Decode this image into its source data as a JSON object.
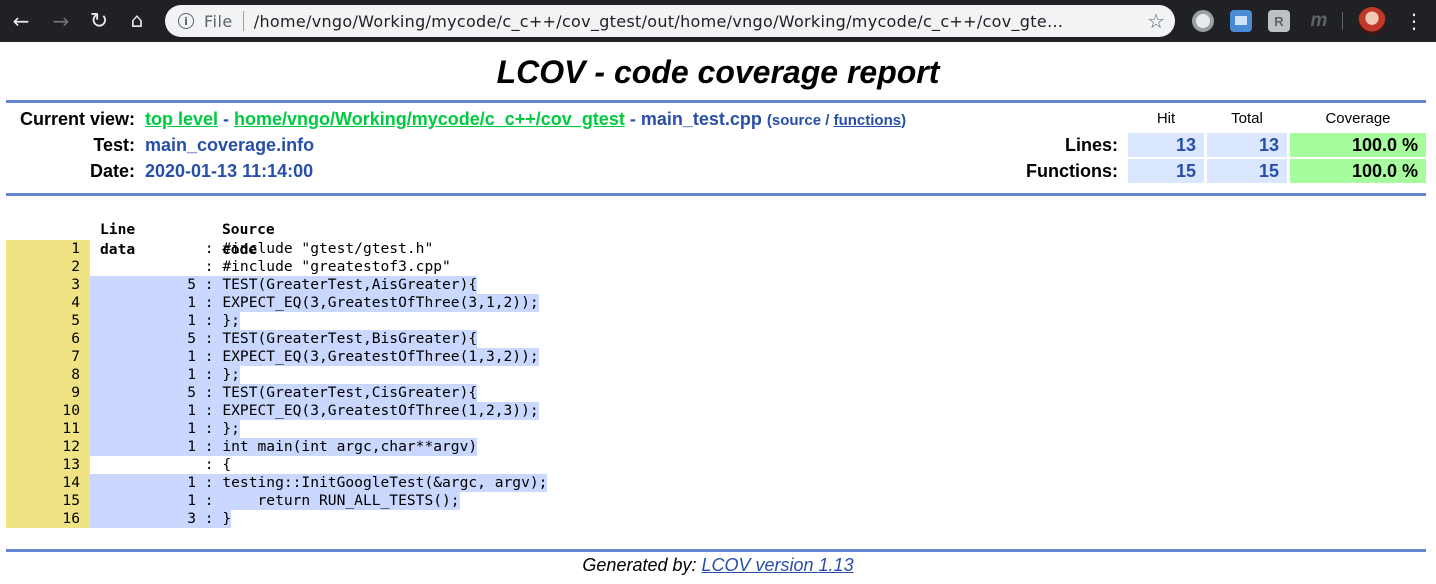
{
  "browser": {
    "back_icon": "arrow-left-icon",
    "forward_icon": "arrow-right-icon",
    "reload_icon": "reload-icon",
    "home_icon": "home-icon",
    "scheme_label": "File",
    "url": "/home/vngo/Working/mycode/c_c++/cov_gtest/out/home/vngo/Working/mycode/c_c++/cov_gte…",
    "star_icon": "star-icon",
    "ext3_label": "R",
    "ext4_label": "m"
  },
  "report": {
    "title": "LCOV - code coverage report",
    "current_view_label": "Current view:",
    "top_level_link": "top level",
    "separator": " - ",
    "path_link": "home/vngo/Working/mycode/c_c++/cov_gtest",
    "file_name": "main_test.cpp",
    "source_open": "(source / ",
    "functions_link": "functions",
    "source_close": ")",
    "test_label": "Test:",
    "test_value": "main_coverage.info",
    "date_label": "Date:",
    "date_value": "2020-01-13 11:14:00"
  },
  "stats": {
    "col_hit": "Hit",
    "col_total": "Total",
    "col_coverage": "Coverage",
    "lines_label": "Lines:",
    "lines_hit": "13",
    "lines_total": "13",
    "lines_coverage": "100.0 %",
    "functions_label": "Functions:",
    "functions_hit": "15",
    "functions_total": "15",
    "functions_coverage": "100.0 %"
  },
  "source": {
    "line_data_header": "Line data",
    "source_code_header": "Source code",
    "lines": [
      {
        "no": "1",
        "count": "",
        "code": "#include \"gtest/gtest.h\""
      },
      {
        "no": "2",
        "count": "",
        "code": "#include \"greatestof3.cpp\""
      },
      {
        "no": "3",
        "count": "5",
        "code": "TEST(GreaterTest,AisGreater){"
      },
      {
        "no": "4",
        "count": "1",
        "code": "EXPECT_EQ(3,GreatestOfThree(3,1,2));"
      },
      {
        "no": "5",
        "count": "1",
        "code": "};"
      },
      {
        "no": "6",
        "count": "5",
        "code": "TEST(GreaterTest,BisGreater){"
      },
      {
        "no": "7",
        "count": "1",
        "code": "EXPECT_EQ(3,GreatestOfThree(1,3,2));"
      },
      {
        "no": "8",
        "count": "1",
        "code": "};"
      },
      {
        "no": "9",
        "count": "5",
        "code": "TEST(GreaterTest,CisGreater){"
      },
      {
        "no": "10",
        "count": "1",
        "code": "EXPECT_EQ(3,GreatestOfThree(1,2,3));"
      },
      {
        "no": "11",
        "count": "1",
        "code": "};"
      },
      {
        "no": "12",
        "count": "1",
        "code": "int main(int argc,char**argv)"
      },
      {
        "no": "13",
        "count": "",
        "code": "{"
      },
      {
        "no": "14",
        "count": "1",
        "code": "testing::InitGoogleTest(&argc, argv);"
      },
      {
        "no": "15",
        "count": "1",
        "code": "    return RUN_ALL_TESTS();"
      },
      {
        "no": "16",
        "count": "3",
        "code": "}"
      }
    ]
  },
  "footer": {
    "generated_by": "Generated by: ",
    "lcov_link": "LCOV version 1.13"
  },
  "colors": {
    "ruler": "#6688d4",
    "link_green": "#00cb40",
    "text_blue": "#284fa8",
    "lineno_bg": "#efe383",
    "hit_bg": "#cad7fe",
    "coverage_hi": "#a7fc9d"
  }
}
